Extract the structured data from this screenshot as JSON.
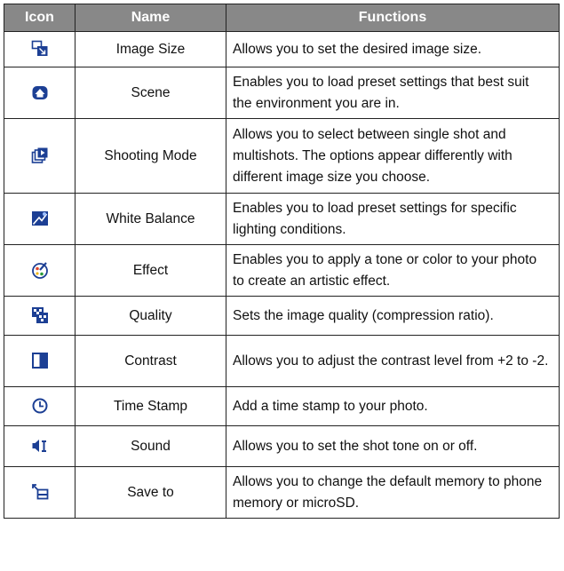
{
  "table": {
    "headers": {
      "icon": "Icon",
      "name": "Name",
      "functions": "Functions"
    },
    "rows": [
      {
        "icon": "image-size-icon",
        "name": "Image Size",
        "function": "Allows you to set the desired image size."
      },
      {
        "icon": "scene-icon",
        "name": "Scene",
        "function": "Enables you to load preset settings that best suit the environment you are in."
      },
      {
        "icon": "shooting-mode-icon",
        "name": "Shooting Mode",
        "function": "Allows you to select between single shot and multishots. The options appear differently with different image size you choose."
      },
      {
        "icon": "white-balance-icon",
        "name": "White Balance",
        "function": "Enables you to load preset settings for specific lighting conditions."
      },
      {
        "icon": "effect-icon",
        "name": "Effect",
        "function": "Enables you to apply a tone or color to your photo to create an artistic effect."
      },
      {
        "icon": "quality-icon",
        "name": "Quality",
        "function": "Sets the image quality (compression ratio)."
      },
      {
        "icon": "contrast-icon",
        "name": "Contrast",
        "function": "Allows you to adjust the contrast level from +2 to -2."
      },
      {
        "icon": "time-stamp-icon",
        "name": "Time Stamp",
        "function": "Add a time stamp to your photo."
      },
      {
        "icon": "sound-icon",
        "name": "Sound",
        "function": "Allows you to set the shot tone on or off."
      },
      {
        "icon": "save-to-icon",
        "name": "Save to",
        "function": "Allows you to change the default memory to phone memory or microSD."
      }
    ]
  },
  "colors": {
    "header_bg": "#888888",
    "icon_blue": "#1c3f94",
    "border": "#222222"
  }
}
